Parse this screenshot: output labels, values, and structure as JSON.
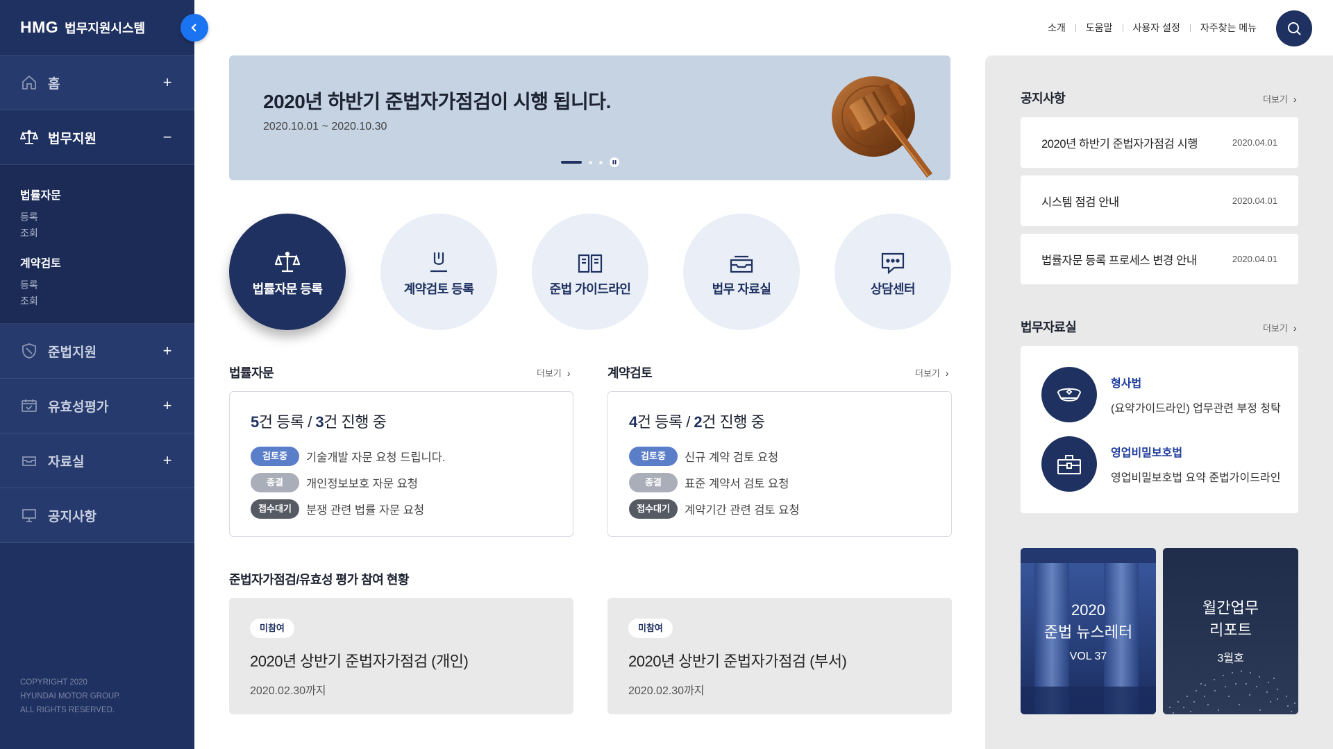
{
  "sidebar": {
    "logo": "HMG",
    "system_name": "법무지원시스템",
    "items": [
      {
        "label": "홈",
        "icon": "home-icon",
        "toggle": "+"
      },
      {
        "label": "법무지원",
        "icon": "scale-icon",
        "toggle": "−"
      },
      {
        "label": "준법지원",
        "icon": "shield-icon",
        "toggle": "+"
      },
      {
        "label": "유효성평가",
        "icon": "calendar-check-icon",
        "toggle": "+"
      },
      {
        "label": "자료실",
        "icon": "inbox-icon",
        "toggle": "+"
      },
      {
        "label": "공지사항",
        "icon": "board-icon",
        "toggle": ""
      }
    ],
    "submenu": {
      "group1": {
        "title": "법률자문",
        "items": [
          "등록",
          "조회"
        ]
      },
      "group2": {
        "title": "계약검토",
        "items": [
          "등록",
          "조회"
        ]
      }
    },
    "copyright": [
      "COPYRIGHT 2020",
      "HYUNDAI MOTOR GROUP.",
      "ALL RIGHTS RESERVED."
    ]
  },
  "topnav": {
    "links": [
      "소개",
      "도움말",
      "사용자 설정",
      "자주찾는 메뉴"
    ]
  },
  "banner": {
    "title": "2020년 하반기 준법자가점검이 시행 됩니다.",
    "date": "2020.10.01 ~ 2020.10.30"
  },
  "quick_links": [
    {
      "label": "법률자문 등록",
      "icon": "scale-icon"
    },
    {
      "label": "계약검토 등록",
      "icon": "pen-sign-icon"
    },
    {
      "label": "준법 가이드라인",
      "icon": "open-book-icon"
    },
    {
      "label": "법무 자료실",
      "icon": "inbox-icon"
    },
    {
      "label": "상담센터",
      "icon": "chat-bubble-icon"
    }
  ],
  "legal_advice": {
    "title": "법률자문",
    "more": "더보기",
    "registered": "5",
    "registered_suffix": "건 등록 / ",
    "in_progress": "3",
    "in_progress_suffix": "건 진행 중",
    "rows": [
      {
        "status": "검토중",
        "text": "기술개발 자문 요청 드립니다."
      },
      {
        "status": "종결",
        "text": "개인정보보호 자문 요청"
      },
      {
        "status": "접수대기",
        "text": "분쟁 관련 법률 자문 요청"
      }
    ]
  },
  "contract_review": {
    "title": "계약검토",
    "more": "더보기",
    "registered": "4",
    "registered_suffix": "건 등록 / ",
    "in_progress": "2",
    "in_progress_suffix": "건 진행 중",
    "rows": [
      {
        "status": "검토중",
        "text": "신규 계약 검토 요청"
      },
      {
        "status": "종결",
        "text": "표준 계약서 검토 요청"
      },
      {
        "status": "접수대기",
        "text": "계약기간 관련 검토 요청"
      }
    ]
  },
  "participation": {
    "title": "준법자가점검/유효성 평가 참여 현황",
    "cards": [
      {
        "badge": "미참여",
        "title": "2020년 상반기 준법자가점검 (개인)",
        "date": "2020.02.30까지"
      },
      {
        "badge": "미참여",
        "title": "2020년 상반기 준법자가점검 (부서)",
        "date": "2020.02.30까지"
      }
    ]
  },
  "notices": {
    "title": "공지사항",
    "more": "더보기",
    "items": [
      {
        "text": "2020년 하반기 준법자가점검 시행",
        "date": "2020.04.01"
      },
      {
        "text": "시스템 점검 안내",
        "date": "2020.04.01"
      },
      {
        "text": "법률자문 등록 프로세스 변경 안내",
        "date": "2020.04.01"
      }
    ]
  },
  "library": {
    "title": "법무자료실",
    "more": "더보기",
    "items": [
      {
        "title": "형사법",
        "desc": "(요약가이드라인) 업무관련 부정 청탁",
        "icon": "police-cap-icon"
      },
      {
        "title": "영업비밀보호법",
        "desc": "영업비밀보호법 요약 준법가이드라인",
        "icon": "briefcase-lock-icon"
      }
    ]
  },
  "tiles": [
    {
      "line1": "2020",
      "line2": "준법 뉴스레터",
      "line3": "VOL 37"
    },
    {
      "line1": "월간업무",
      "line2": "리포트",
      "line3": "3월호"
    }
  ],
  "colors": {
    "navy": "#1f3160",
    "accent_blue": "#1a73f0",
    "banner_bg": "#c5d3e3",
    "badge_review": "#5b7ec9",
    "badge_done": "#a9aeb8",
    "badge_wait": "#555a63"
  }
}
